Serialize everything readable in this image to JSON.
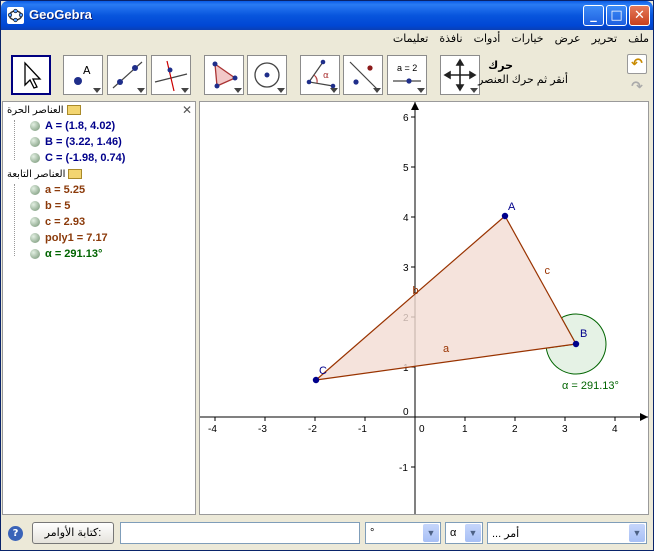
{
  "window": {
    "title": "GeoGebra"
  },
  "menu": [
    "ملف",
    "تحرير",
    "عرض",
    "خيارات",
    "أدوات",
    "نافذة",
    "تعليمات"
  ],
  "toolbar": {
    "help_title": "حرك",
    "help_text": "أنقر ثم حرك العنصر",
    "input_box_label": "a = 2"
  },
  "algebra": {
    "free_folder": "العناصر الحرة",
    "dependent_folder": "العناصر التابعة",
    "free_objects": [
      "A = (1.8, 4.02)",
      "B = (3.22, 1.46)",
      "C = (-1.98, 0.74)"
    ],
    "dependent_objects": [
      "a = 5.25",
      "b = 5",
      "c = 2.93",
      "poly1 = 7.17",
      "α = 291.13°"
    ]
  },
  "graphics": {
    "points": [
      {
        "name": "A",
        "x": 1.8,
        "y": 4.02
      },
      {
        "name": "B",
        "x": 3.22,
        "y": 1.46
      },
      {
        "name": "C",
        "x": -1.98,
        "y": 0.74
      }
    ],
    "segment_labels": [
      "a",
      "b",
      "c"
    ],
    "angle_label": "α = 291.13°",
    "x_ticks": [
      "-4",
      "-3",
      "-2",
      "-1",
      "0",
      "1",
      "2",
      "3",
      "4"
    ],
    "y_ticks": [
      "-1",
      "0",
      "1",
      "2",
      "3",
      "4",
      "5",
      "6"
    ],
    "colors": {
      "polygon_fill": "#f2dcd3",
      "polygon_edge": "#993300",
      "angle": "#006400",
      "point": "#00008b"
    }
  },
  "inputbar": {
    "label_button": "كتابة الأوامر:",
    "combo1": "°",
    "combo2": "α",
    "combo3": "أمر ..."
  }
}
